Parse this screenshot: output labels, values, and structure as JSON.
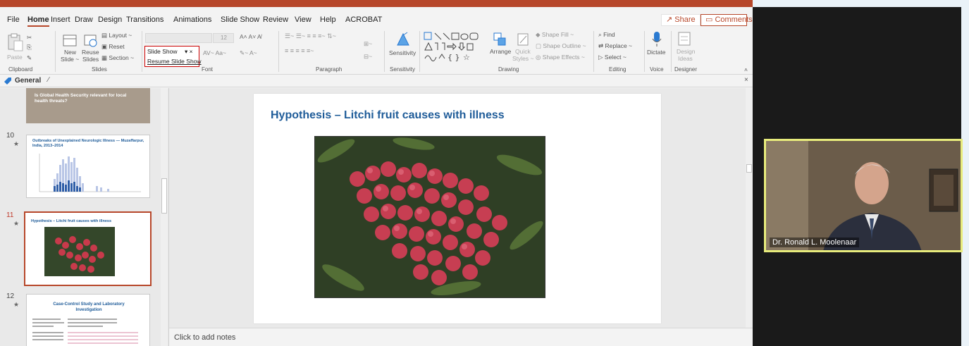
{
  "menu": {
    "tabs": [
      "File",
      "Home",
      "Insert",
      "Draw",
      "Design",
      "Transitions",
      "Animations",
      "Slide Show",
      "Review",
      "View",
      "Help",
      "ACROBAT"
    ],
    "active": "Home",
    "share_label": "Share",
    "comments_label": "Comments"
  },
  "ribbon": {
    "clipboard": {
      "paste": "Paste",
      "label": "Clipboard"
    },
    "slides": {
      "new_slide": "New",
      "new_slide2": "Slide ~",
      "reuse": "Reuse",
      "reuse2": "Slides",
      "layout": "Layout ~",
      "reset": "Reset",
      "section": "Section ~",
      "label": "Slides"
    },
    "font": {
      "size": "12",
      "slideshow_item": "Slide Show",
      "resume_item": "Resume Slide Show",
      "label": "Font"
    },
    "paragraph": {
      "label": "Paragraph"
    },
    "sensitivity": {
      "button": "Sensitivity",
      "label": "Sensitivity"
    },
    "drawing": {
      "arrange": "Arrange",
      "quick_styles": "Quick",
      "quick_styles2": "Styles ~",
      "shape_fill": "Shape Fill ~",
      "shape_outline": "Shape Outline ~",
      "shape_effects": "Shape Effects ~",
      "label": "Drawing"
    },
    "editing": {
      "find": "Find",
      "replace": "Replace ~",
      "select": "Select ~",
      "label": "Editing"
    },
    "voice": {
      "dictate": "Dictate",
      "label": "Voice"
    },
    "designer": {
      "ideas": "Design",
      "ideas2": "Ideas",
      "label": "Designer"
    }
  },
  "section": {
    "name": "General"
  },
  "thumbnails": [
    {
      "number": "",
      "title": "Is Global Health Security relevant for local health threats?"
    },
    {
      "number": "10",
      "title": "Outbreaks of Unexplained Neurologic Illness — Muzaffarpur, India, 2013–2014"
    },
    {
      "number": "11",
      "title": "Hypothesis – Litchi fruit causes with illness",
      "selected": true
    },
    {
      "number": "12",
      "title": "Case-Control Study and Laboratory Investigation"
    }
  ],
  "slide": {
    "title": "Hypothesis – Litchi fruit causes with illness"
  },
  "notes": {
    "placeholder": "Click to add notes"
  },
  "video": {
    "participant": "Dr. Ronald L. Moolenaar"
  },
  "colors": {
    "accent": "#b7472a",
    "slide_title": "#1f5c99",
    "video_border": "#e8ec7c"
  }
}
